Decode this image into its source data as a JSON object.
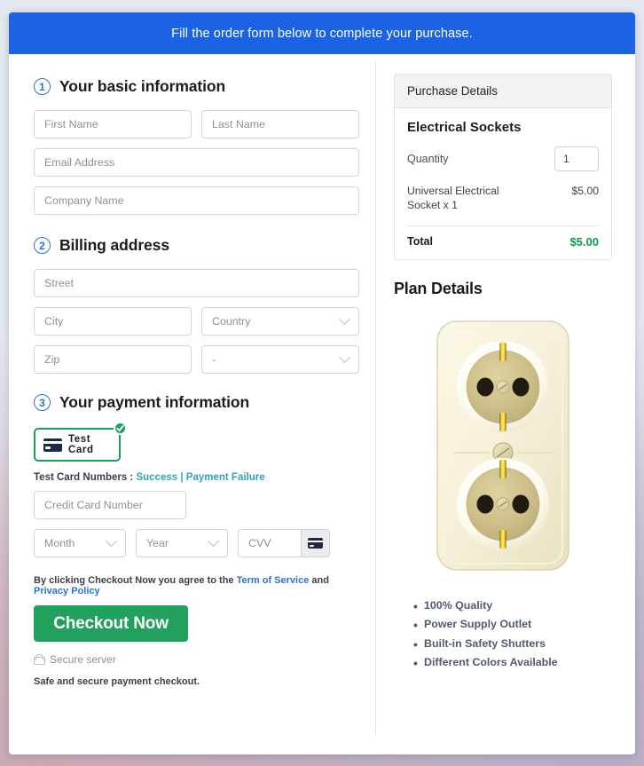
{
  "banner": {
    "text": "Fill the order form below to complete your purchase."
  },
  "sections": {
    "basic": {
      "number": "1",
      "title": "Your basic information"
    },
    "billing": {
      "number": "2",
      "title": "Billing address"
    },
    "payment": {
      "number": "3",
      "title": "Your payment information"
    }
  },
  "fields": {
    "first_name": "First Name",
    "last_name": "Last Name",
    "email": "Email Address",
    "company": "Company Name",
    "street": "Street",
    "city": "City",
    "country": "Country",
    "zip": "Zip",
    "state": "-",
    "card_number": "Credit Card Number",
    "month": "Month",
    "year": "Year",
    "cvv": "CVV"
  },
  "payment": {
    "tile_label": "Test Card",
    "tile_icon": "credit-card-icon",
    "selected_badge": "check-circle-icon",
    "test_numbers_label": "Test Card Numbers :",
    "link_success": "Success",
    "link_separator": "|",
    "link_failure": "Payment Failure",
    "cvv_icon": "credit-card-icon"
  },
  "footer": {
    "terms_prefix": "By clicking Checkout Now you agree to the",
    "terms_link": "Term of Service",
    "terms_and": "and",
    "privacy_link": "Privacy Policy",
    "checkout_label": "Checkout Now",
    "secure_icon": "lock-icon",
    "secure_label": "Secure server",
    "safe_note": "Safe and secure payment checkout."
  },
  "purchase": {
    "header": "Purchase Details",
    "product_title": "Electrical Sockets",
    "quantity_label": "Quantity",
    "quantity_value": "1",
    "line_item_name": "Universal Electrical Socket x 1",
    "line_item_price": "$5.00",
    "total_label": "Total",
    "total_value": "$5.00"
  },
  "plan": {
    "title": "Plan Details",
    "image_name": "electrical-socket-image",
    "features": [
      "100% Quality",
      "Power Supply Outlet",
      "Built-in Safety Shutters",
      "Different Colors Available"
    ]
  },
  "colors": {
    "banner_blue": "#1b63e3",
    "accent_blue": "#2b6fe0",
    "checkout_green": "#21a05e",
    "total_green": "#0d9c4f",
    "tile_green": "#18a05c",
    "link_teal": "#2fa3b5"
  }
}
